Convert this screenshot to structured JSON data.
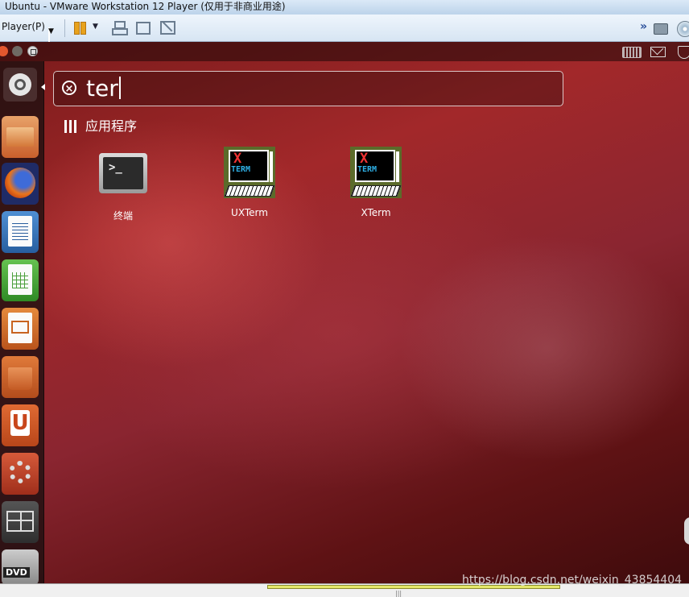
{
  "window": {
    "title": "Ubuntu - VMware Workstation 12 Player (仅用于非商业用途)"
  },
  "toolbar": {
    "player_menu": "Player(P)"
  },
  "dash": {
    "search_query": "ter",
    "category_label": "应用程序",
    "apps": [
      {
        "label": "终端"
      },
      {
        "label": "UXTerm"
      },
      {
        "label": "XTerm"
      }
    ]
  },
  "xterm_icon": {
    "x_letter": "X",
    "term_text": "TERM"
  },
  "watermark": "https://blog.csdn.net/weixin_43854404",
  "colors": {
    "wallpaper": "#8a2530",
    "launcher_bg": "#1f0f0f",
    "close_button": "#e4572e"
  }
}
